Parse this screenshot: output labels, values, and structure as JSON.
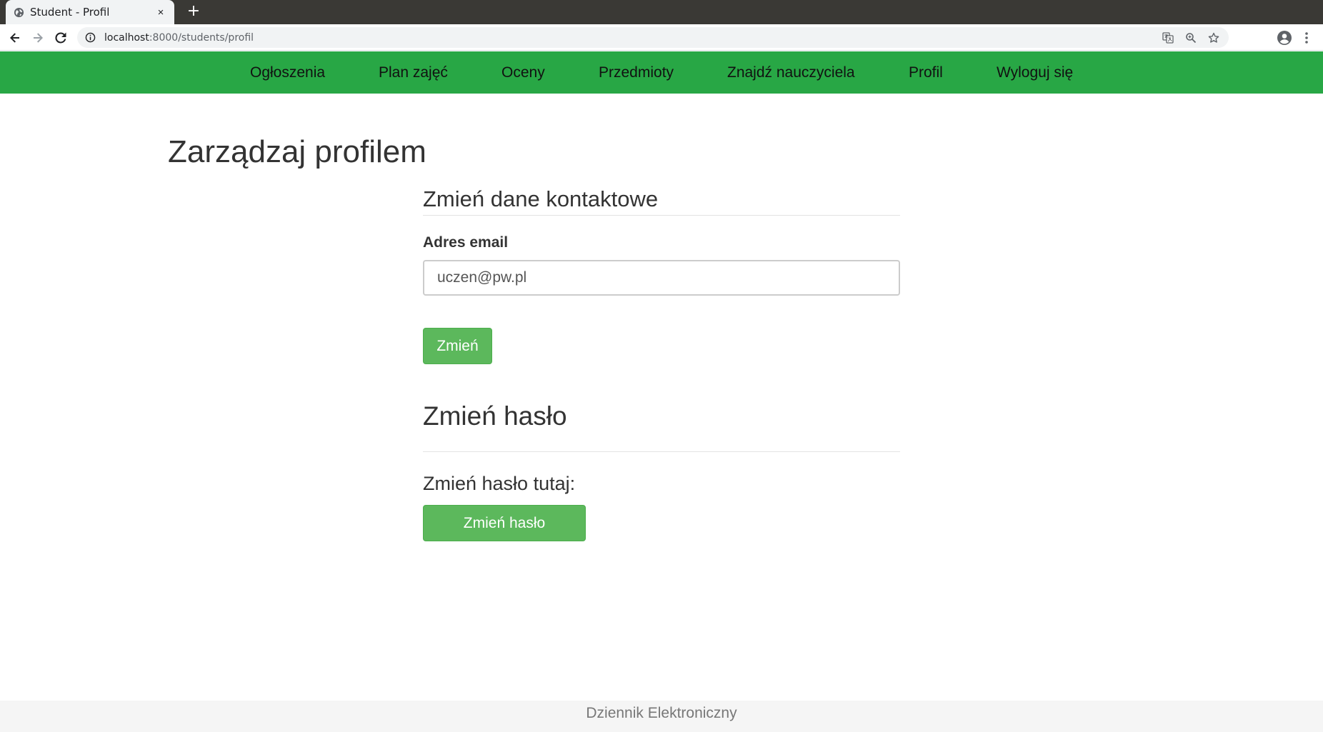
{
  "browser": {
    "tab_title": "Student - Profil",
    "tab_close": "×",
    "new_tab": "+",
    "url_host": "localhost",
    "url_path": ":8000/students/profil"
  },
  "nav": {
    "items": [
      {
        "label": "Ogłoszenia"
      },
      {
        "label": "Plan zajęć"
      },
      {
        "label": "Oceny"
      },
      {
        "label": "Przedmioty"
      },
      {
        "label": "Znajdź nauczyciela"
      },
      {
        "label": "Profil"
      },
      {
        "label": "Wyloguj się"
      }
    ]
  },
  "main": {
    "page_title": "Zarządzaj profilem",
    "contact": {
      "heading": "Zmień dane kontaktowe",
      "email_label": "Adres email",
      "email_value": "uczen@pw.pl",
      "submit_label": "Zmień"
    },
    "password": {
      "heading": "Zmień hasło",
      "prompt": "Zmień hasło tutaj:",
      "button_label": "Zmień hasło"
    }
  },
  "footer": {
    "text": "Dziennik Elektroniczny"
  },
  "colors": {
    "navbar": "#28a745",
    "button": "#5cb85c",
    "tabstrip": "#3a3935"
  },
  "icons": {
    "favicon": "globe-icon",
    "back": "arrow-left-icon",
    "forward": "arrow-right-icon",
    "reload": "reload-icon",
    "info": "info-icon",
    "translate": "translate-icon",
    "zoom": "zoom-icon",
    "bookmark": "star-icon",
    "profile": "account-icon",
    "menu": "kebab-menu-icon"
  }
}
